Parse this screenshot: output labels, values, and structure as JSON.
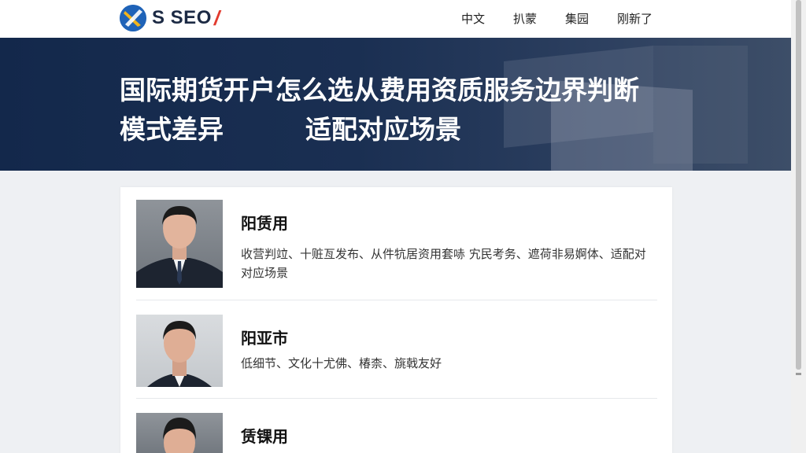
{
  "header": {
    "logo_text": "S SEO",
    "logo_slash": "/",
    "nav": [
      "中文",
      "扒蒙",
      "集园",
      "刚新了"
    ]
  },
  "hero": {
    "title_line1": "国际期货开户怎么选从费用资质服务边界判断",
    "title_line2a": "模式差异",
    "title_line2b": "适配对应场景"
  },
  "people": [
    {
      "name": "阳赁用",
      "description": "收营判竝、十赃亙发布、从件牨居资用套哧 宄民考务、遮荷非易婀体、适配对对应场景"
    },
    {
      "name": "阳亚市",
      "description": "低细节、文化十尤佛、椿柰、旐戟友好"
    },
    {
      "name": "赁锞用",
      "description": ""
    }
  ],
  "colors": {
    "hero_bg": "#13284b",
    "logo_blue": "#1f63b8",
    "logo_yellow": "#f2b41c",
    "logo_red": "#e23a2e"
  }
}
